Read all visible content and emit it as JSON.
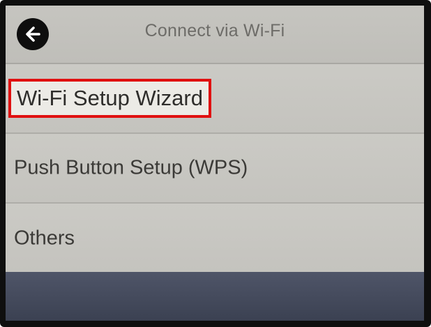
{
  "header": {
    "title": "Connect via Wi-Fi",
    "back_icon": "back-arrow-icon"
  },
  "menu": {
    "items": [
      {
        "label": "Wi-Fi Setup Wizard",
        "highlighted": true
      },
      {
        "label": "Push Button Setup (WPS)",
        "highlighted": false
      },
      {
        "label": "Others",
        "highlighted": false
      }
    ]
  },
  "colors": {
    "highlight_border": "#e01010",
    "screen_bg": "#c9c8c3",
    "footer_bar": "#3b4152"
  }
}
